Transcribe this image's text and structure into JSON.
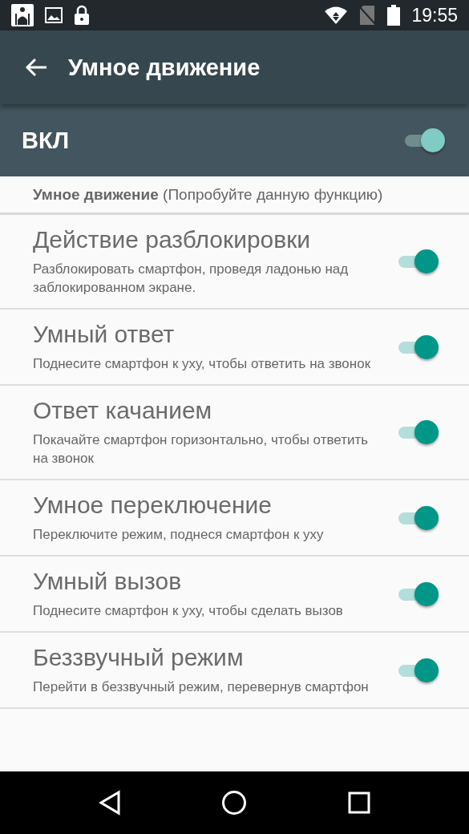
{
  "status_bar": {
    "time": "19:55"
  },
  "app_bar": {
    "title": "Умное движение"
  },
  "master": {
    "label": "ВКЛ",
    "on": true
  },
  "intro": "**Умное движение** (Попробуйте данную функцию)",
  "items": [
    {
      "title": "Действие разблокировки",
      "summary": "Разблокировать смартфон, проведя ладонью над заблокированном экране.",
      "on": true
    },
    {
      "title": "Умный ответ",
      "summary": "Поднесите смартфон к уху, чтобы ответить на звонок",
      "on": true
    },
    {
      "title": "Ответ качанием",
      "summary": "Покачайте смартфон горизонтально, чтобы ответить на звонок",
      "on": true
    },
    {
      "title": "Умное переключение",
      "summary": "Переключите режим, поднеся смартфон к уху",
      "on": true
    },
    {
      "title": "Умный вызов",
      "summary": "Поднесите смартфон к уху, чтобы сделать вызов",
      "on": true
    },
    {
      "title": "Беззвучный режим",
      "summary": "Перейти в беззвучный режим, перевернув смартфон",
      "on": true
    }
  ]
}
